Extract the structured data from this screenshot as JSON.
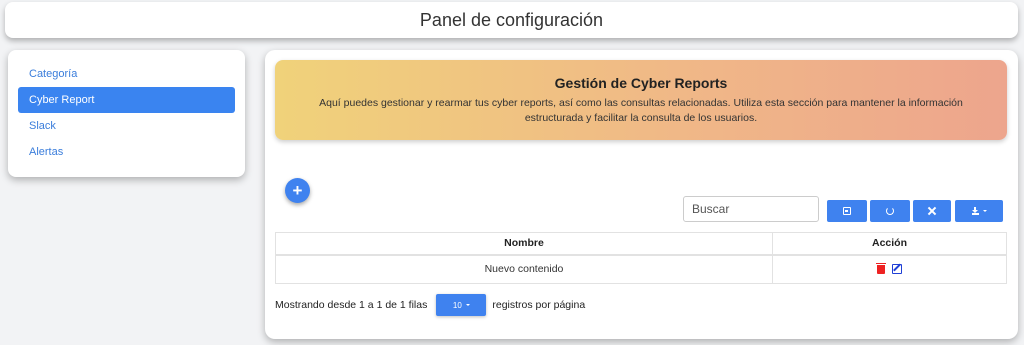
{
  "header": {
    "title": "Panel de configuración"
  },
  "sidebar": {
    "items": [
      {
        "label": "Categoría"
      },
      {
        "label": "Cyber Report"
      },
      {
        "label": "Slack"
      },
      {
        "label": "Alertas"
      }
    ],
    "active": "Cyber Report"
  },
  "banner": {
    "title": "Gestión de Cyber Reports",
    "description": "Aquí puedes gestionar y rearmar tus cyber reports, así como las consultas relacionadas. Utiliza esta sección para mantener la información estructurada y facilitar la consulta de los usuarios."
  },
  "toolbar": {
    "add_icon": "+",
    "search_placeholder": "Buscar",
    "buttons": [
      "toggle-view-icon",
      "refresh-icon",
      "fullscreen-icon",
      "export-icon"
    ]
  },
  "table": {
    "headers": [
      "Nombre",
      "Acción"
    ],
    "rows": [
      {
        "nombre": "Nuevo contenido",
        "actions": [
          "trash-icon",
          "edit-icon"
        ]
      }
    ]
  },
  "pagination": {
    "showing_text": "Mostrando desde 1 a 1 de 1 filas",
    "page_size": "10",
    "per_page_text": "registros por página"
  },
  "colors": {
    "accent": "#3f82ef",
    "danger": "#e22222",
    "banner_gradient": [
      "#f0d27a",
      "#eda58d"
    ]
  }
}
